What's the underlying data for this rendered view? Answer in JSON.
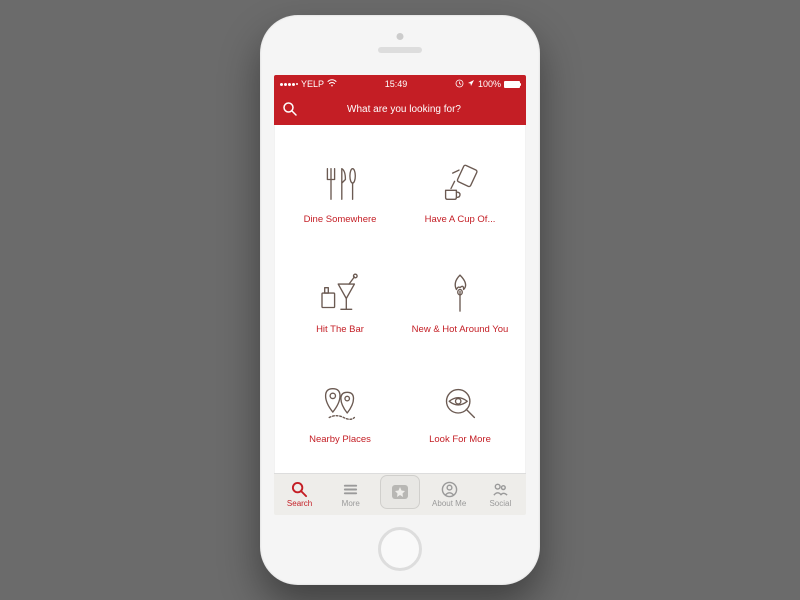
{
  "status": {
    "carrier": "YELP",
    "time": "15:49",
    "battery": "100%"
  },
  "search": {
    "placeholder": "What are you looking for?"
  },
  "tiles": {
    "dine": "Dine Somewhere",
    "coffee": "Have A Cup Of...",
    "bar": "Hit The Bar",
    "hot": "New & Hot Around You",
    "nearby": "Nearby Places",
    "more": "Look For More"
  },
  "tabs": {
    "search": "Search",
    "more": "More",
    "about": "About Me",
    "social": "Social"
  },
  "colors": {
    "primary": "#c41e25",
    "iconStroke": "#6b5a52"
  }
}
